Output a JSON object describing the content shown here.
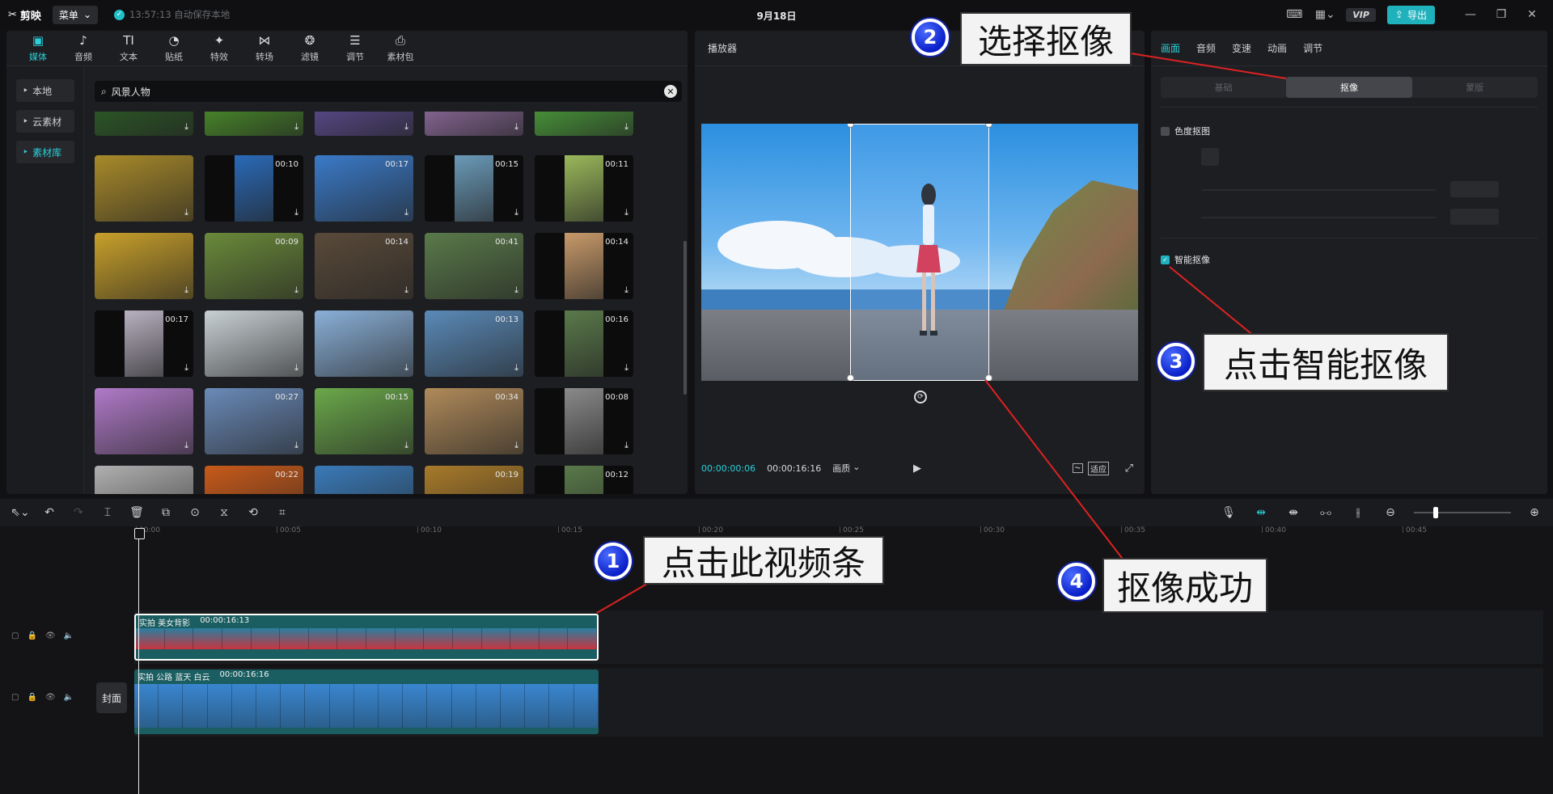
{
  "titlebar": {
    "app_name": "剪映",
    "menu_label": "菜单",
    "autosave": "13:57:13 自动保存本地",
    "doc_title": "9月18日",
    "vip": "VIP",
    "export": "导出"
  },
  "media_tabs": [
    {
      "label": "媒体",
      "icon": "▣"
    },
    {
      "label": "音频",
      "icon": "♪"
    },
    {
      "label": "文本",
      "icon": "TI"
    },
    {
      "label": "贴纸",
      "icon": "◔"
    },
    {
      "label": "特效",
      "icon": "✦"
    },
    {
      "label": "转场",
      "icon": "⋈"
    },
    {
      "label": "滤镜",
      "icon": "❂"
    },
    {
      "label": "调节",
      "icon": "☰"
    },
    {
      "label": "素材包",
      "icon": "⎙"
    }
  ],
  "sidebar": [
    {
      "label": "本地"
    },
    {
      "label": "云素材"
    },
    {
      "label": "素材库"
    }
  ],
  "search": {
    "value": "风景人物"
  },
  "grid": {
    "rows": [
      [
        {
          "dur": ""
        },
        {
          "dur": ""
        },
        {
          "dur": ""
        },
        {
          "dur": ""
        },
        {
          "dur": ""
        }
      ],
      [
        {
          "dur": ""
        },
        {
          "dur": "00:10"
        },
        {
          "dur": "00:17"
        },
        {
          "dur": "00:15"
        },
        {
          "dur": "00:11"
        }
      ],
      [
        {
          "dur": ""
        },
        {
          "dur": "00:09"
        },
        {
          "dur": "00:14"
        },
        {
          "dur": "00:41"
        },
        {
          "dur": "00:14"
        }
      ],
      [
        {
          "dur": "00:17"
        },
        {
          "dur": ""
        },
        {
          "dur": ""
        },
        {
          "dur": "00:13"
        },
        {
          "dur": "00:16"
        }
      ],
      [
        {
          "dur": ""
        },
        {
          "dur": "00:27"
        },
        {
          "dur": "00:15"
        },
        {
          "dur": "00:34"
        },
        {
          "dur": "00:08"
        }
      ],
      [
        {
          "dur": ""
        },
        {
          "dur": "00:22"
        },
        {
          "dur": ""
        },
        {
          "dur": "00:19"
        },
        {
          "dur": "00:12"
        }
      ]
    ],
    "colors": [
      [
        "#2c5a26",
        "#4a8c2a",
        "#5a4a8c",
        "#8c6a9a",
        "#4a9a3a"
      ],
      [
        "#a88a2a",
        "#2a6ab8",
        "#3a7ac8",
        "#6a9ab8",
        "#9ab85a"
      ],
      [
        "#c8a02a",
        "#6a8a3a",
        "#5a4a3a",
        "#5a7a4a",
        "#c89a6a"
      ],
      [
        "#b8b0c0",
        "#c8d0d4",
        "#8ab0d8",
        "#5a8ab8",
        "#5a7a4a"
      ],
      [
        "#b07ac8",
        "#6a8ab8",
        "#6aa84a",
        "#b08a5a",
        "#8a8a8a"
      ],
      [
        "#b0b0b0",
        "#c85a1a",
        "#3a7ab8",
        "#a87a2a",
        "#5a7a4a"
      ]
    ]
  },
  "player": {
    "title": "播放器",
    "time_current": "00:00:00:06",
    "time_total": "00:00:16:16",
    "quality": "画质",
    "fit": "适应"
  },
  "props": {
    "tabs": [
      "画面",
      "音频",
      "变速",
      "动画",
      "调节"
    ],
    "subtabs": [
      "基础",
      "抠像",
      "蒙版"
    ],
    "chroma_key": "色度抠图",
    "smart_cutout": "智能抠像"
  },
  "timeline": {
    "ruler": [
      "00:00",
      "00:05",
      "00:10",
      "00:15",
      "00:20",
      "00:25",
      "00:30",
      "00:35",
      "00:40",
      "00:45"
    ],
    "clip1": {
      "name": "实拍 美女背影",
      "duration": "00:00:16:13"
    },
    "clip2": {
      "name": "实拍 公路 蓝天 白云",
      "duration": "00:00:16:16"
    },
    "cover": "封面"
  },
  "annotations": [
    {
      "num": "1",
      "text": "点击此视频条"
    },
    {
      "num": "2",
      "text": "选择抠像"
    },
    {
      "num": "3",
      "text": "点击智能抠像"
    },
    {
      "num": "4",
      "text": "抠像成功"
    }
  ],
  "colors": {
    "accent": "#2ad0d9",
    "panel": "#1d1e22",
    "bg": "#111113",
    "clip_bg": "#1a5e62"
  }
}
